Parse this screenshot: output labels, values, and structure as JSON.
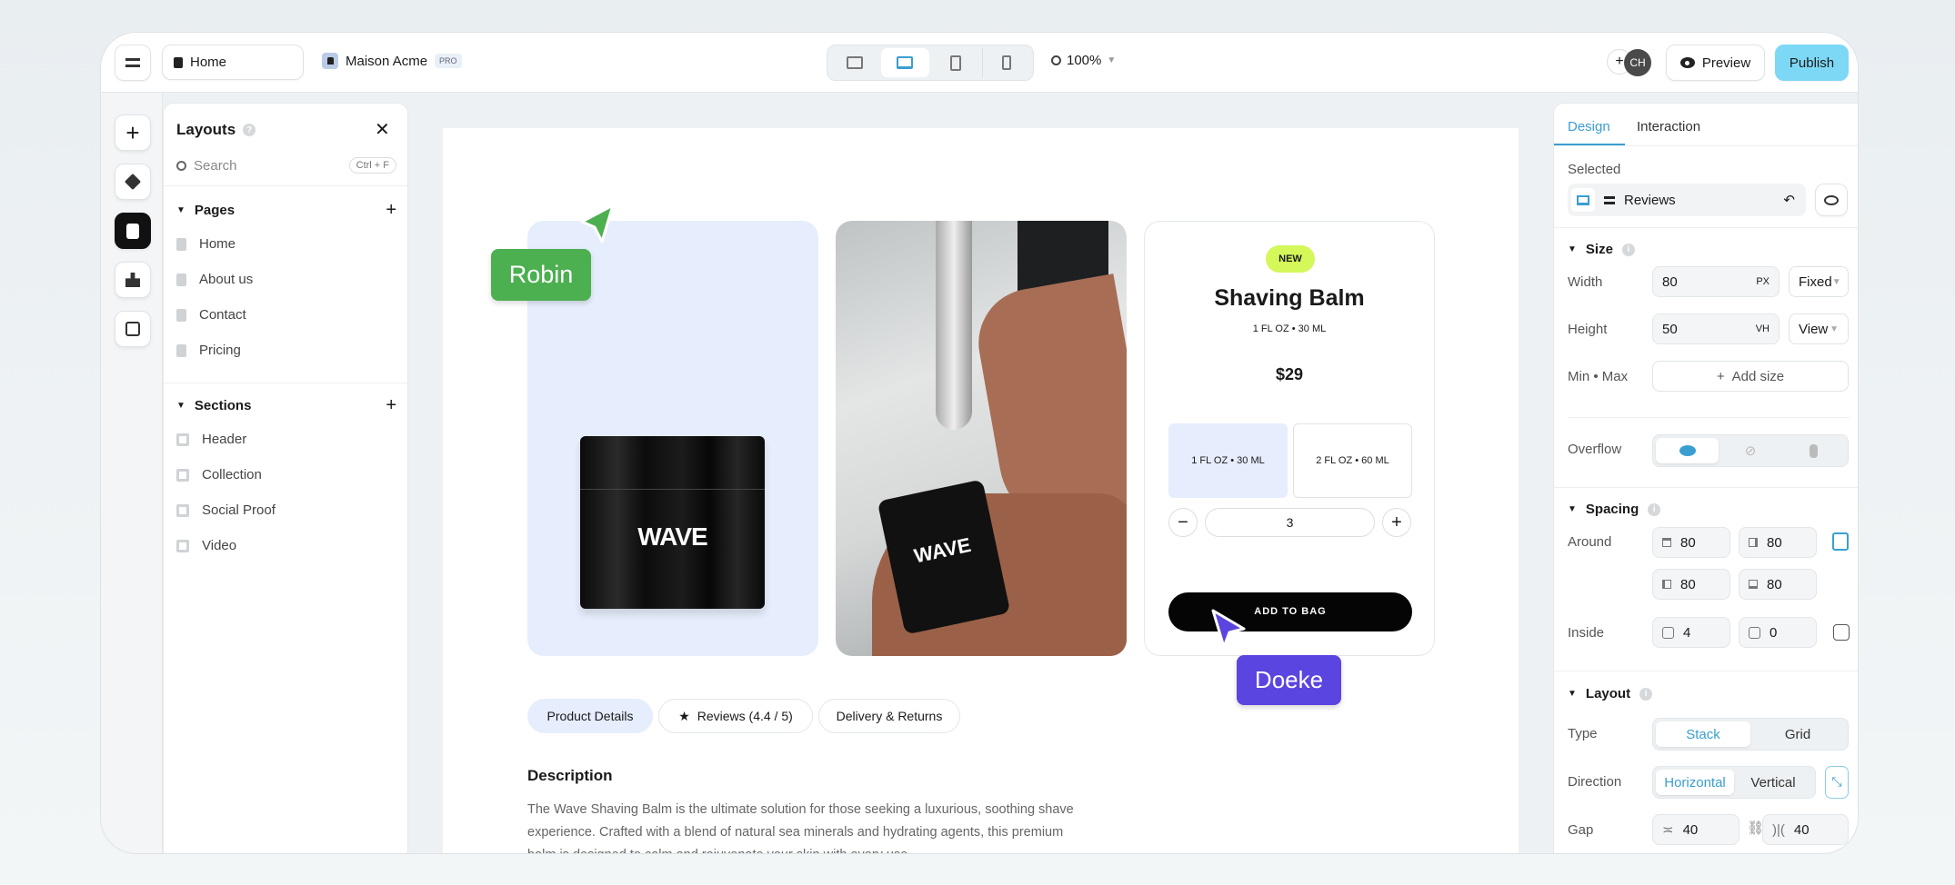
{
  "topbar": {
    "page_field": "Home",
    "site_name": "Maison Acme",
    "plan_badge": "PRO",
    "zoom": "100%",
    "avatar_initials": "CH",
    "preview_label": "Preview",
    "publish_label": "Publish",
    "active_device": "laptop"
  },
  "layouts": {
    "title": "Layouts",
    "search_placeholder": "Search",
    "search_shortcut": "Ctrl + F",
    "pages_heading": "Pages",
    "pages": [
      "Home",
      "About us",
      "Contact",
      "Pricing"
    ],
    "sections_heading": "Sections",
    "sections": [
      "Header",
      "Collection",
      "Social Proof",
      "Video"
    ]
  },
  "product": {
    "badge": "NEW",
    "title": "Shaving Balm",
    "subtitle": "1 FL OZ • 30 ML",
    "price": "$29",
    "variants": [
      {
        "label": "1 FL OZ • 30 ML",
        "selected": true
      },
      {
        "label": "2 FL OZ • 60 ML",
        "selected": false
      }
    ],
    "quantity": "3",
    "add_to_bag": "ADD TO BAG",
    "brand_label": "WAVE",
    "tabs": [
      "Product Details",
      "Reviews (4.4 / 5)",
      "Delivery & Returns"
    ],
    "description_heading": "Description",
    "description": [
      "The Wave Shaving Balm is the ultimate solution for those seeking a luxurious, soothing shave",
      "experience. Crafted with a blend of natural sea minerals and hydrating agents, this premium",
      "balm is designed to calm and rejuvenate your skin with every use."
    ]
  },
  "cursors": [
    {
      "name": "Robin",
      "color": "#4caf50"
    },
    {
      "name": "Doeke",
      "color": "#5b45e0"
    }
  ],
  "design": {
    "tabs": [
      "Design",
      "Interaction"
    ],
    "selected_label": "Selected",
    "selected_item": "Reviews",
    "size": {
      "heading": "Size",
      "width_label": "Width",
      "width_value": "80",
      "width_unit": "PX",
      "width_mode": "Fixed",
      "height_label": "Height",
      "height_value": "50",
      "height_unit": "VH",
      "height_mode": "View",
      "minmax_label": "Min • Max",
      "add_size": "Add size",
      "overflow_label": "Overflow"
    },
    "spacing": {
      "heading": "Spacing",
      "around_label": "Around",
      "top": "80",
      "right": "80",
      "left": "80",
      "bottom": "80",
      "inside_label": "Inside",
      "inside_v": "4",
      "inside_h": "0"
    },
    "layout": {
      "heading": "Layout",
      "type_label": "Type",
      "type_options": [
        "Stack",
        "Grid"
      ],
      "direction_label": "Direction",
      "direction_options": [
        "Horizontal",
        "Vertical"
      ],
      "gap_label": "Gap",
      "gap_row": "40",
      "gap_col": "40"
    }
  },
  "colors": {
    "accent": "#3a9fd0",
    "publish": "#7dd8f5",
    "new_badge": "#d4f75a",
    "variant_selected": "#e6edfd",
    "image_bg": "#e6edfc"
  }
}
